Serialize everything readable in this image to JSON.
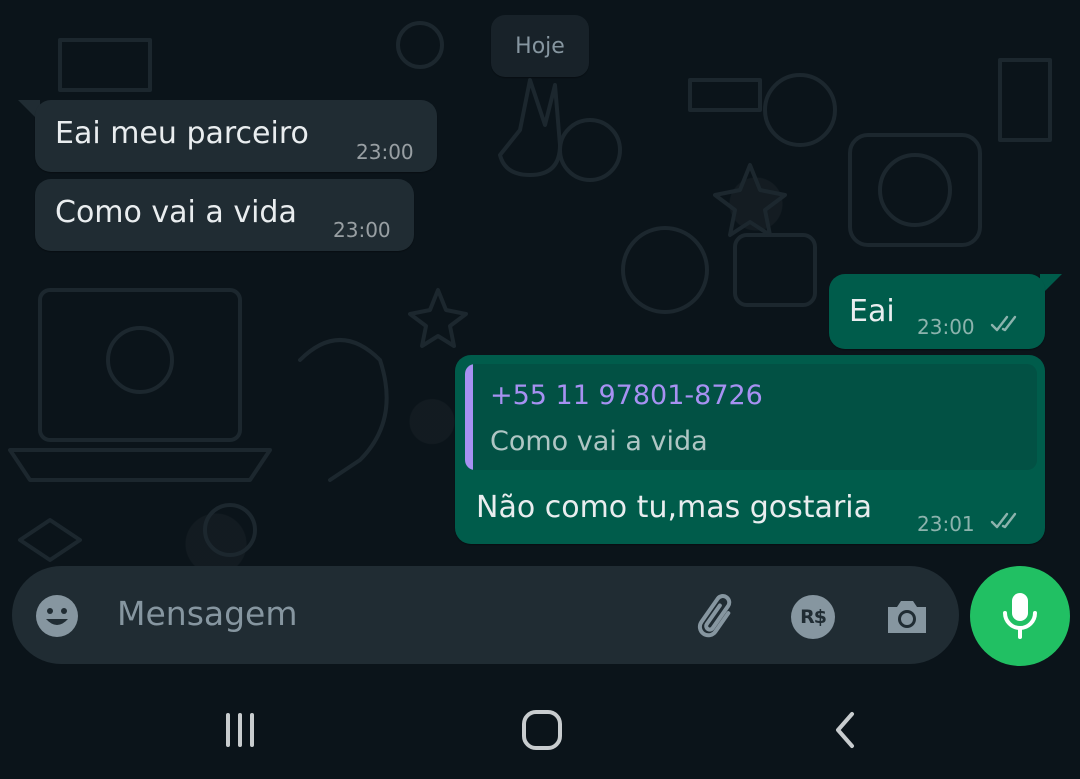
{
  "chat": {
    "date_separator": "Hoje",
    "messages": [
      {
        "direction": "incoming",
        "text": "Eai meu parceiro",
        "time": "23:00"
      },
      {
        "direction": "incoming",
        "text": "Como vai a vida",
        "time": "23:00"
      },
      {
        "direction": "outgoing",
        "text": "Eai",
        "time": "23:00",
        "status": "read-double-check"
      },
      {
        "direction": "outgoing",
        "text": "Não como tu,mas gostaria",
        "time": "23:01",
        "status": "read-double-check",
        "reply_to": {
          "author": "+55 11 97801-8726",
          "text": "Como vai a vida"
        }
      }
    ]
  },
  "composer": {
    "placeholder": "Mensagem",
    "icons": [
      "emoji-icon",
      "attach-icon",
      "payment-icon",
      "camera-icon",
      "mic-icon"
    ],
    "payment_label": "R$"
  },
  "navbar": {
    "buttons": [
      "recent-apps",
      "home",
      "back"
    ]
  },
  "colors": {
    "background": "#0b141a",
    "incoming_bubble": "#202c33",
    "outgoing_bubble": "#005c4b",
    "quote_accent": "#a791f2",
    "mic_button": "#21c063"
  }
}
